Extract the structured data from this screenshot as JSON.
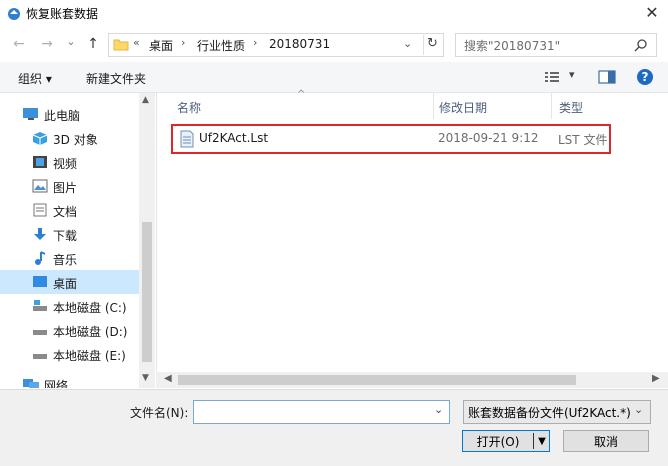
{
  "window": {
    "title": "恢复账套数据",
    "close_glyph": "✕"
  },
  "nav": {
    "back_glyph": "←",
    "forward_glyph": "→",
    "recent_glyph": "⌄",
    "up_glyph": "↑",
    "overflow": "«",
    "breadcrumbs": [
      "桌面",
      "行业性质",
      "20180731"
    ],
    "search_placeholder": "搜索\"20180731\""
  },
  "toolbar": {
    "organize": "组织 ▾",
    "new_folder": "新建文件夹"
  },
  "sidebar": {
    "items": [
      {
        "label": "此电脑",
        "icon": "pc-icon"
      },
      {
        "label": "3D 对象",
        "icon": "cube-icon"
      },
      {
        "label": "视频",
        "icon": "video-icon"
      },
      {
        "label": "图片",
        "icon": "picture-icon"
      },
      {
        "label": "文档",
        "icon": "document-icon"
      },
      {
        "label": "下载",
        "icon": "download-icon"
      },
      {
        "label": "音乐",
        "icon": "music-icon"
      },
      {
        "label": "桌面",
        "icon": "desktop-icon"
      },
      {
        "label": "本地磁盘 (C:)",
        "icon": "drive-icon"
      },
      {
        "label": "本地磁盘 (D:)",
        "icon": "drive-icon"
      },
      {
        "label": "本地磁盘 (E:)",
        "icon": "drive-icon"
      },
      {
        "label": "网络",
        "icon": "network-icon"
      }
    ],
    "selected": "桌面"
  },
  "file_list": {
    "columns": [
      "名称",
      "修改日期",
      "类型"
    ],
    "rows": [
      {
        "name": "Uf2KAct.Lst",
        "modified": "2018-09-21 9:12",
        "type": "LST 文件"
      }
    ]
  },
  "footer": {
    "filename_label": "文件名(N):",
    "filename_value": "",
    "filter_value": "账套数据备份文件(Uf2KAct.*)",
    "open_button": "打开(O)",
    "cancel_button": "取消"
  },
  "colors": {
    "highlight_border": "#e0262c",
    "selected_bg": "#cce8ff",
    "accent": "#0078d7"
  }
}
